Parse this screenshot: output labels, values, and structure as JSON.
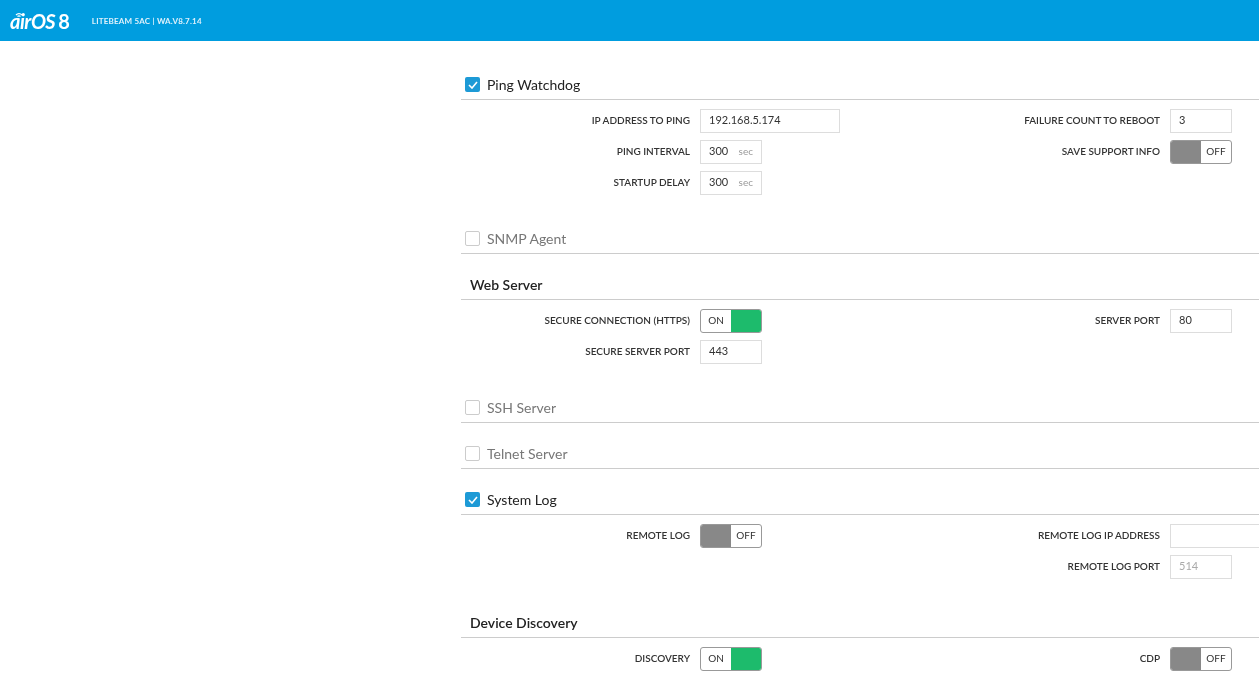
{
  "header": {
    "logo": "airOS",
    "logo_version": "8",
    "device": "LITEBEAM 5AC | WA.V8.7.14"
  },
  "sections": [
    {
      "title": "Ping Watchdog",
      "kind": "checkbox",
      "checked": true,
      "left": [
        {
          "kind": "address",
          "label": "IP ADDRESS TO PING",
          "value": "192.168.5.174"
        },
        {
          "kind": "unit",
          "label": "PING INTERVAL",
          "value": "300",
          "unit": "sec"
        },
        {
          "kind": "unit",
          "label": "STARTUP DELAY",
          "value": "300",
          "unit": "sec"
        }
      ],
      "right": [
        {
          "kind": "number",
          "label": "FAILURE COUNT TO REBOOT",
          "value": "3"
        },
        {
          "kind": "toggle",
          "label": "SAVE SUPPORT INFO",
          "on": false,
          "text": "OFF"
        }
      ]
    },
    {
      "title": "SNMP Agent",
      "kind": "checkbox",
      "checked": false
    },
    {
      "title": "Web Server",
      "kind": "plain",
      "left": [
        {
          "kind": "toggle",
          "label": "SECURE CONNECTION (HTTPS)",
          "on": true,
          "text": "ON"
        },
        {
          "kind": "number",
          "label": "SECURE SERVER PORT",
          "value": "443"
        }
      ],
      "right": [
        {
          "kind": "number",
          "label": "SERVER PORT",
          "value": "80"
        }
      ]
    },
    {
      "title": "SSH Server",
      "kind": "checkbox",
      "checked": false
    },
    {
      "title": "Telnet Server",
      "kind": "checkbox",
      "checked": false
    },
    {
      "title": "System Log",
      "kind": "checkbox",
      "checked": true,
      "left": [
        {
          "kind": "toggle",
          "label": "REMOTE LOG",
          "on": false,
          "text": "OFF"
        }
      ],
      "right": [
        {
          "kind": "address",
          "label": "REMOTE LOG IP ADDRESS"
        },
        {
          "kind": "number",
          "label": "REMOTE LOG PORT",
          "placeholder": "514"
        }
      ]
    },
    {
      "title": "Device Discovery",
      "kind": "plain",
      "left": [
        {
          "kind": "toggle",
          "label": "DISCOVERY",
          "on": true,
          "text": "ON"
        }
      ],
      "right": [
        {
          "kind": "toggle",
          "label": "CDP",
          "on": false,
          "text": "OFF"
        }
      ]
    }
  ]
}
